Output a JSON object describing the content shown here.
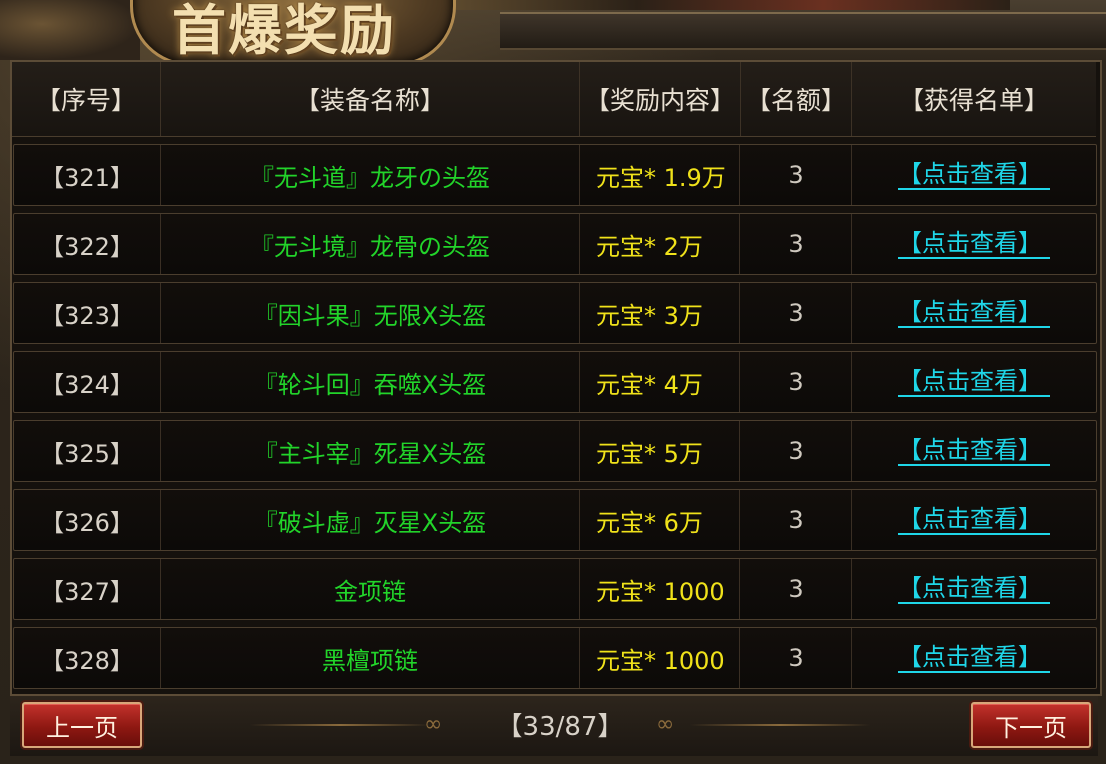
{
  "banner": {
    "title": "首爆奖励"
  },
  "table": {
    "headers": [
      "【序号】",
      "【装备名称】",
      "【奖励内容】",
      "【名额】",
      "【获得名单】"
    ],
    "rows": [
      {
        "index": "【321】",
        "name": "『无斗道』龙牙の头盔",
        "reward": "元宝*  1.9万",
        "quota": "3",
        "link": "【点击查看】"
      },
      {
        "index": "【322】",
        "name": "『无斗境』龙骨の头盔",
        "reward": "元宝*  2万",
        "quota": "3",
        "link": "【点击查看】"
      },
      {
        "index": "【323】",
        "name": "『因斗果』无限Ⅹ头盔",
        "reward": "元宝*  3万",
        "quota": "3",
        "link": "【点击查看】"
      },
      {
        "index": "【324】",
        "name": "『轮斗回』吞噬Ⅹ头盔",
        "reward": "元宝*  4万",
        "quota": "3",
        "link": "【点击查看】"
      },
      {
        "index": "【325】",
        "name": "『主斗宰』死星Ⅹ头盔",
        "reward": "元宝*  5万",
        "quota": "3",
        "link": "【点击查看】"
      },
      {
        "index": "【326】",
        "name": "『破斗虚』灭星Ⅹ头盔",
        "reward": "元宝*  6万",
        "quota": "3",
        "link": "【点击查看】"
      },
      {
        "index": "【327】",
        "name": "金项链",
        "reward": "元宝*  1000",
        "quota": "3",
        "link": "【点击查看】"
      },
      {
        "index": "【328】",
        "name": "黑檀项链",
        "reward": "元宝*  1000",
        "quota": "3",
        "link": "【点击查看】"
      }
    ]
  },
  "pager": {
    "prev_label": "上一页",
    "next_label": "下一页",
    "page_text": "【33/87】"
  },
  "colors": {
    "name_green": "#22d42a",
    "reward_yellow": "#f0e21a",
    "link_cyan": "#1fd6e8",
    "button_red": "#8e1812"
  }
}
